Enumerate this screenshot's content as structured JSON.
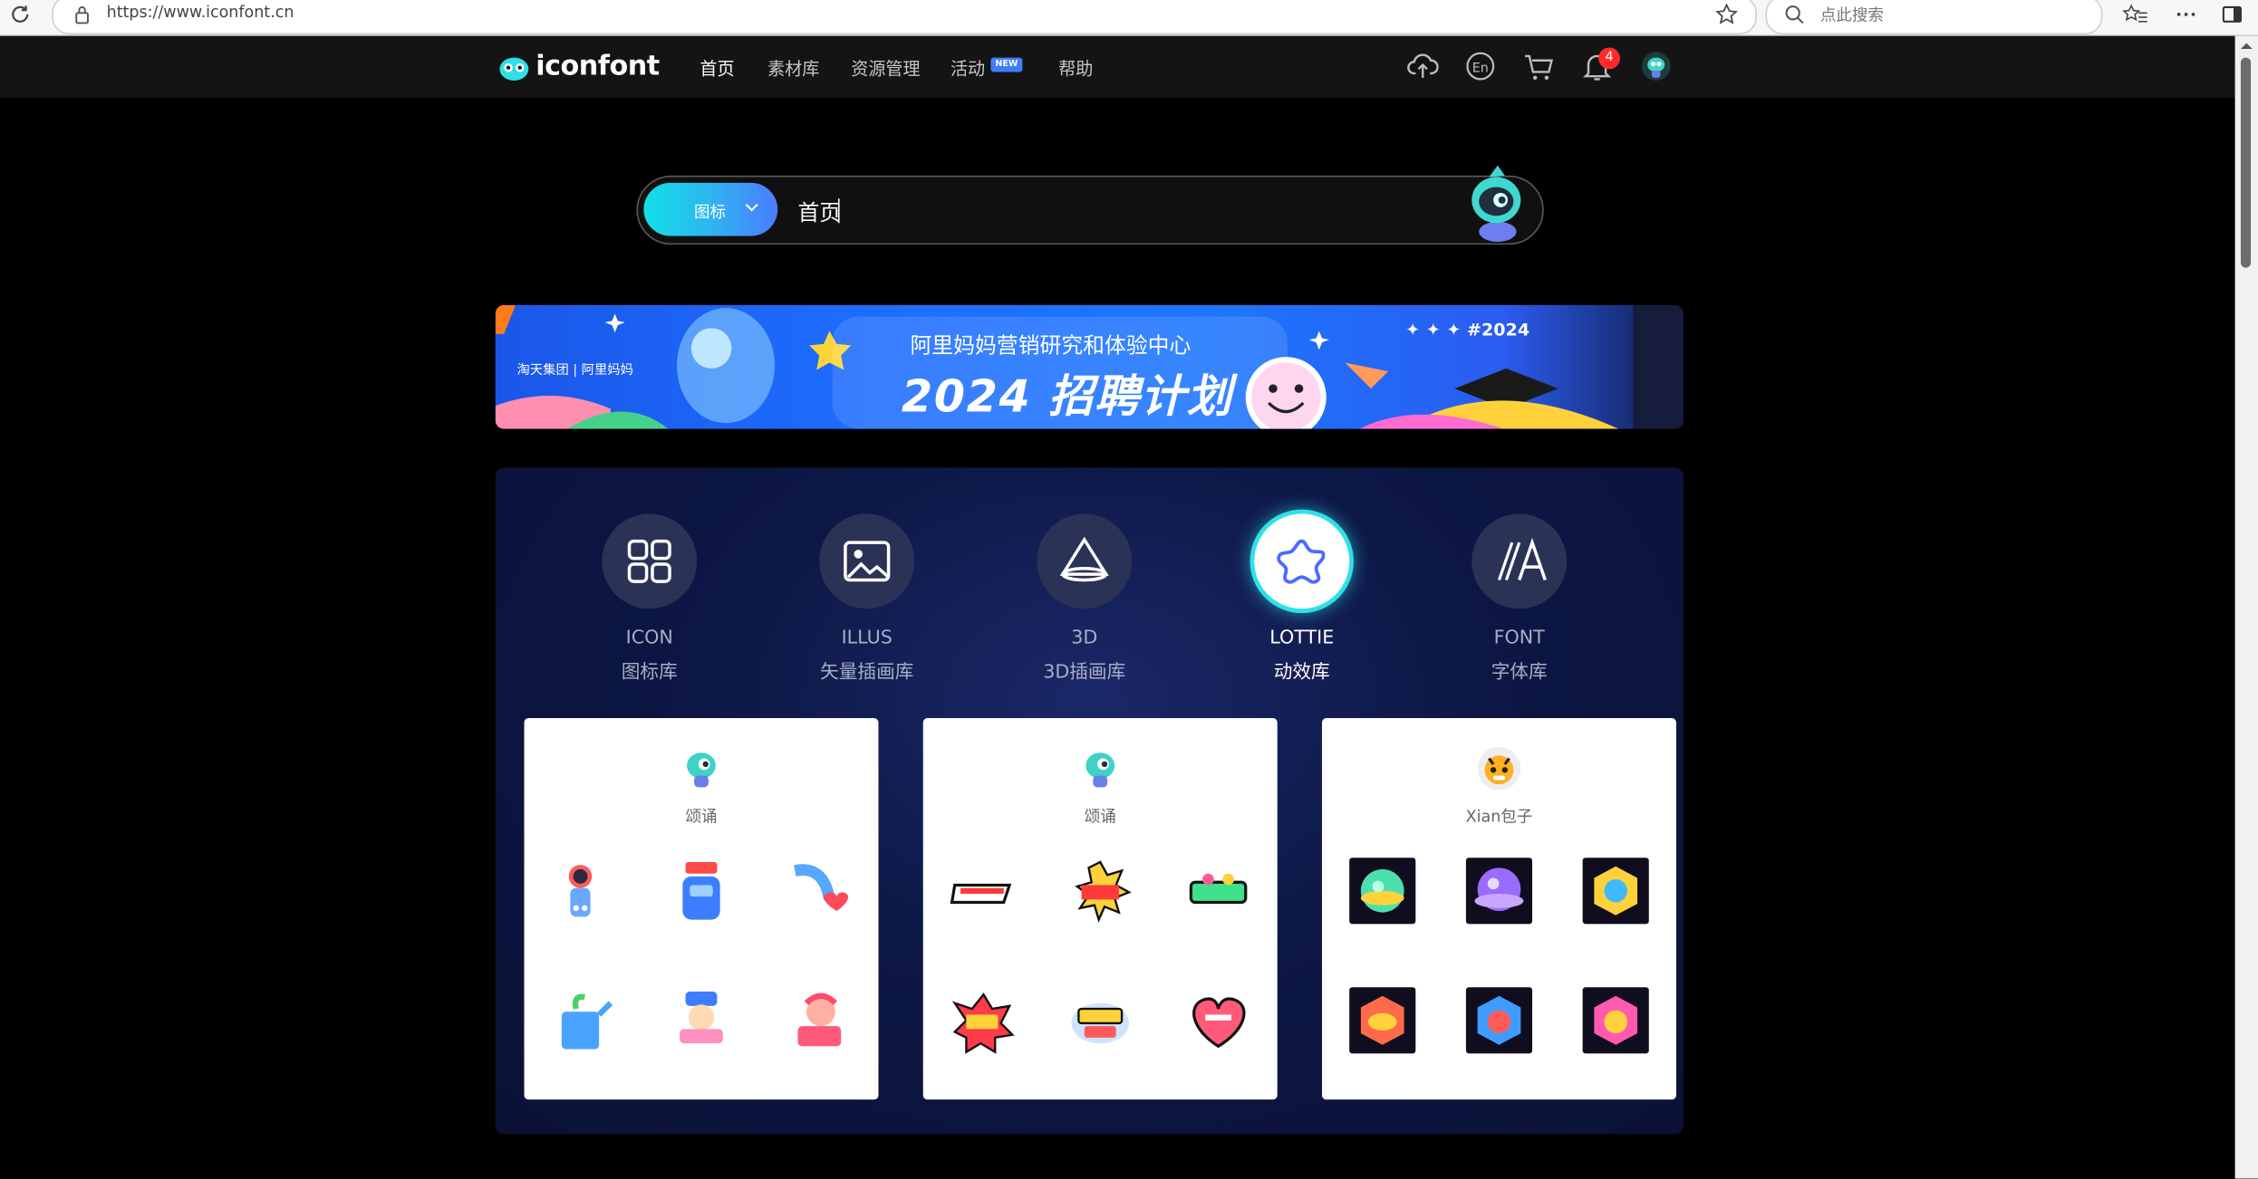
{
  "browser": {
    "url": "https://www.iconfont.cn",
    "search_placeholder": "点此搜索"
  },
  "nav": {
    "logo": "iconfont",
    "items": [
      {
        "label": "首页",
        "active": true
      },
      {
        "label": "素材库",
        "active": false
      },
      {
        "label": "资源管理",
        "active": false
      },
      {
        "label": "活动",
        "active": false
      },
      {
        "label": "帮助",
        "active": false
      }
    ],
    "new_badge": "NEW",
    "notification_count": "4",
    "lang_icon": "En"
  },
  "search": {
    "type_label": "图标",
    "query": "首页"
  },
  "banner": {
    "line1": "阿里妈妈营销研究和体验中心",
    "line2": "2024 招聘计划",
    "tag": "#2024",
    "brand": "淘天集团 | 阿里妈妈"
  },
  "categories": [
    {
      "en": "ICON",
      "cn": "图标库",
      "icon": "grid-icon",
      "active": false
    },
    {
      "en": "ILLUS",
      "cn": "矢量插画库",
      "icon": "image-icon",
      "active": false
    },
    {
      "en": "3D",
      "cn": "3D插画库",
      "icon": "cone-icon",
      "active": false
    },
    {
      "en": "LOTTIE",
      "cn": "动效库",
      "icon": "star-blob-icon",
      "active": true
    },
    {
      "en": "FONT",
      "cn": "字体库",
      "icon": "font-a-icon",
      "active": false
    }
  ],
  "cards": [
    {
      "author": "颂诵"
    },
    {
      "author": "颂诵"
    },
    {
      "author": "Xian包子"
    }
  ],
  "colors": {
    "accent_cyan": "#2fe0e8",
    "accent_blue": "#4a7cff",
    "nav_bg": "#141414",
    "panel_bg": "#0d1745",
    "badge_red": "#ff2b2b"
  }
}
